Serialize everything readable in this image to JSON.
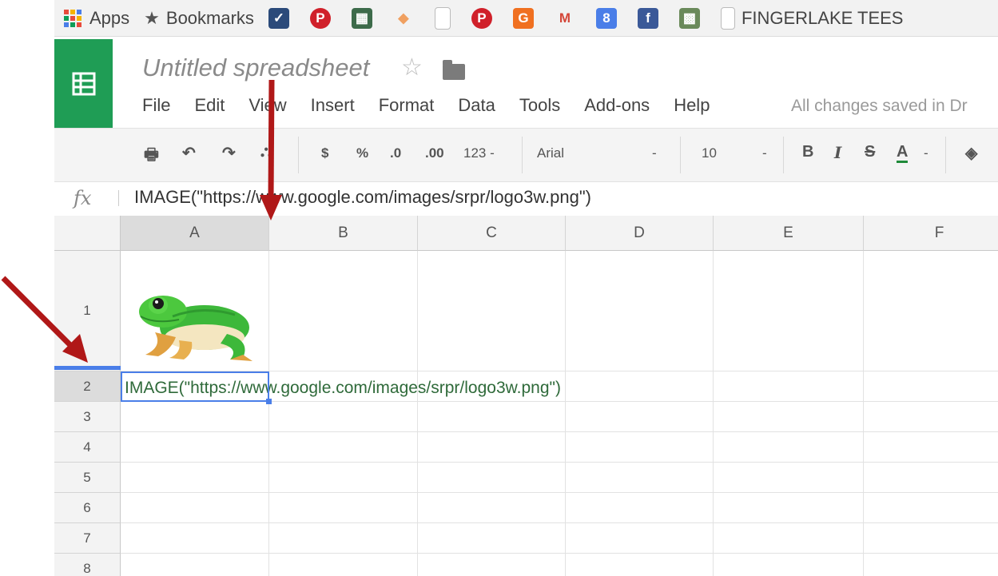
{
  "bookmarks": {
    "items": [
      {
        "label": "Apps",
        "icon": "apps-grid-icon"
      },
      {
        "label": "Bookmarks",
        "icon": "star-icon"
      },
      {
        "label": "",
        "icon": "checklist-icon",
        "color": "#2b4a7a"
      },
      {
        "label": "",
        "icon": "pinterest-icon",
        "color": "#d0202a"
      },
      {
        "label": "",
        "icon": "photo-icon",
        "color": "#3d6b4a"
      },
      {
        "label": "",
        "icon": "fish-icon",
        "color": "#f0a060"
      },
      {
        "label": "",
        "icon": "page-icon",
        "color": "#cccccc"
      },
      {
        "label": "",
        "icon": "pinterest-icon",
        "color": "#d0202a"
      },
      {
        "label": "",
        "icon": "g-icon",
        "color": "#f07020"
      },
      {
        "label": "",
        "icon": "gmail-icon",
        "color": "#d44638"
      },
      {
        "label": "",
        "icon": "google-plus-icon",
        "color": "#4a7ee8"
      },
      {
        "label": "",
        "icon": "facebook-icon",
        "color": "#3b5998"
      },
      {
        "label": "",
        "icon": "map-icon",
        "color": "#6a8a5a"
      },
      {
        "label": "FINGERLAKE TEES",
        "icon": "page-icon"
      }
    ]
  },
  "header": {
    "title": "Untitled spreadsheet",
    "menu": [
      "File",
      "Edit",
      "View",
      "Insert",
      "Format",
      "Data",
      "Tools",
      "Add-ons",
      "Help"
    ],
    "saved_status": "All changes saved in Dr"
  },
  "toolbar": {
    "currency": "$",
    "percent": "%",
    "decimal_decrease": ".0",
    "decimal_increase": ".00",
    "number_format": "123 -",
    "font": "Arial",
    "font_dropdown": "-",
    "font_size": "10",
    "size_dropdown": "-",
    "bold": "B",
    "italic": "I",
    "strike": "S",
    "text_color": "A",
    "color_dropdown": "-"
  },
  "formula_bar": {
    "fx": "fx",
    "formula": "IMAGE(\"https://www.google.com/images/srpr/logo3w.png\")"
  },
  "grid": {
    "columns": [
      "A",
      "B",
      "C",
      "D",
      "E",
      "F"
    ],
    "rows": [
      "1",
      "2",
      "3",
      "4",
      "5",
      "6",
      "7",
      "8"
    ],
    "cell_a2": "IMAGE(\"https://www.google.com/images/srpr/logo3w.png\")",
    "selected_column": "A",
    "selected_row": "2"
  },
  "colors": {
    "brand_green": "#1f9d55",
    "selection_blue": "#4a7ee8",
    "arrow_red": "#b01818"
  }
}
